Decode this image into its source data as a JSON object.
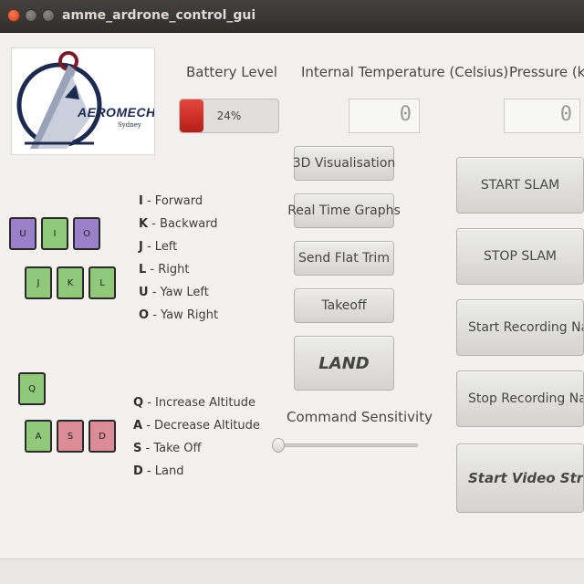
{
  "window": {
    "title": "amme_ardrone_control_gui"
  },
  "logo": {
    "brand": "AEROMECH",
    "subtitle": "Sydney"
  },
  "battery": {
    "label": "Battery Level",
    "value_text": "24%",
    "level": 0.24
  },
  "temperature": {
    "label": "Internal Temperature (Celsius)",
    "value": "0"
  },
  "pressure": {
    "label": "Pressure (kPa",
    "value": "0"
  },
  "buttons": {
    "visualisation": "3D Visualisation",
    "graphs": "Real Time Graphs",
    "flat_trim": "Send Flat Trim",
    "takeoff": "Takeoff",
    "land": "LAND",
    "start_slam": "START SLAM",
    "stop_slam": "STOP SLAM",
    "start_recording": "Start Recording Navdat",
    "stop_recording": "Stop Recording Navdat",
    "start_video": "Start Video Strea"
  },
  "sensitivity": {
    "label": "Command Sensitivity",
    "value": 0
  },
  "movement_keys": {
    "top_row": [
      "U",
      "I",
      "O"
    ],
    "bottom_row": [
      "J",
      "K",
      "L"
    ],
    "legend": [
      {
        "key": "I",
        "text": " - Forward"
      },
      {
        "key": "K",
        "text": " - Backward"
      },
      {
        "key": "J",
        "text": " - Left"
      },
      {
        "key": "L",
        "text": " - Right"
      },
      {
        "key": "U",
        "text": " - Yaw Left"
      },
      {
        "key": "O",
        "text": " - Yaw Right"
      }
    ]
  },
  "altitude_keys": {
    "top_row": [
      "Q"
    ],
    "bottom_row": [
      "A",
      "S",
      "D"
    ],
    "legend": [
      {
        "key": "Q",
        "text": " - Increase Altitude"
      },
      {
        "key": "A",
        "text": " - Decrease Altitude"
      },
      {
        "key": "S",
        "text": " - Take Off"
      },
      {
        "key": "D",
        "text": " - Land"
      }
    ]
  },
  "colors": {
    "key_purple": "#9a7fc9",
    "key_green": "#8fc979",
    "key_pink": "#dc8c96",
    "battery_red": "#d0342c",
    "titlebar": "#3a3937"
  }
}
